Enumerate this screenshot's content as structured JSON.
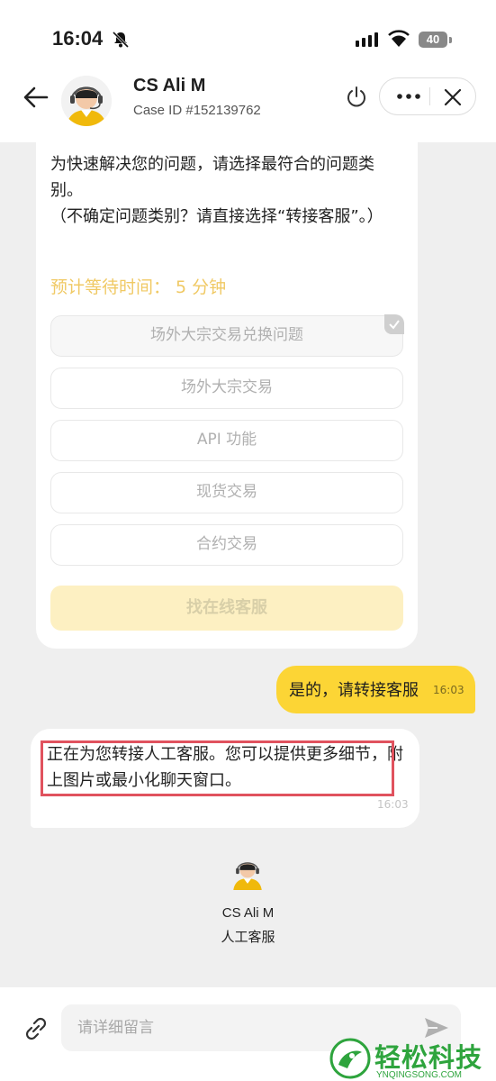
{
  "status_bar": {
    "time": "16:04",
    "battery": "40"
  },
  "header": {
    "agent_name": "CS Ali M",
    "case_id": "Case ID #152139762"
  },
  "bot_card": {
    "intro": "为快速解决您的问题，请选择最符合的问题类别。\n（不确定问题类别？请直接选择“转接客服”。）",
    "wait_time": "预计等待时间： 5 分钟",
    "options": [
      {
        "label": "场外大宗交易兑换问题",
        "selected": true
      },
      {
        "label": "场外大宗交易",
        "selected": false
      },
      {
        "label": "API 功能",
        "selected": false
      },
      {
        "label": "现货交易",
        "selected": false
      },
      {
        "label": "合约交易",
        "selected": false
      }
    ],
    "find_cs_label": "找在线客服"
  },
  "user_message": {
    "text": "是的，请转接客服",
    "time": "16:03"
  },
  "agent_message": {
    "text": "正在为您转接人工客服。您可以提供更多细节，附上图片或最小化聊天窗口。",
    "time": "16:03"
  },
  "agent_info": {
    "name": "CS Ali M",
    "role": "人工客服"
  },
  "composer": {
    "placeholder": "请详细留言",
    "value": ""
  },
  "watermark": {
    "title": "轻松科技",
    "subtitle": "YNQINGSONG.COM"
  },
  "colors": {
    "brand_yellow": "#fcd535",
    "wait_text": "#f0c964",
    "highlight_box": "#e0525e",
    "watermark_green": "#2ea43d"
  },
  "icons": [
    "back-arrow-icon",
    "agent-avatar-icon",
    "power-icon",
    "more-icon",
    "close-icon",
    "attach-icon",
    "send-icon",
    "mute-bell-icon",
    "signal-icon",
    "wifi-icon",
    "battery-icon",
    "check-icon"
  ]
}
